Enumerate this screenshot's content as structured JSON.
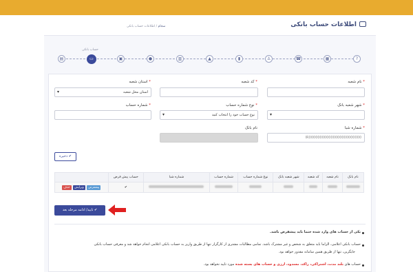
{
  "header": {
    "title": "اطلاعات حساب بانکی",
    "breadcrumb_home": "سجام",
    "breadcrumb_current": "اطلاعات حساب بانکی"
  },
  "steps": {
    "active_label": "حساب بانکی",
    "icons": [
      "document-icon",
      "bank-card-icon",
      "id-card-icon",
      "user-icon",
      "address-card-icon",
      "graduation-cap-icon",
      "bookmark-icon",
      "person-icon",
      "phone-icon",
      "certificate-icon",
      "question-icon",
      "home-icon"
    ]
  },
  "form": {
    "branch_name_label": "نام شعبه",
    "branch_code_label": "کد شعبه",
    "branch_province_label": "استان شعبه",
    "branch_province_value": "استان محل شعبه",
    "branch_city_label": "شهر شعبه بانک",
    "account_type_label": "نوع شماره حساب",
    "account_type_value": "نوع حساب خود را انتخاب کنید",
    "account_number_label": "شماره حساب",
    "sheba_label": "شماره شبا",
    "sheba_value": "IR000000000000000000000000",
    "bank_name_label": "نام بانک",
    "save_label": "ذخیره"
  },
  "table": {
    "headers": [
      "نام بانک",
      "نام شعبه",
      "کد شعبه",
      "شهر شعبه بانک",
      "نوع شماره حساب",
      "شماره حساب",
      "شماره شبا",
      "حساب پیش فرض",
      ""
    ],
    "row": {
      "bank": "بانک ملت",
      "branch": "شعبه",
      "code": "۱۲۳۴",
      "city": "تهران",
      "type": "کوتاه مدت",
      "default_mark": "✔",
      "delete": "حذف",
      "edit": "ویرایش",
      "set_default": "پیشفرض"
    }
  },
  "confirm_label": "تایید/ ادامه مرحله بعد",
  "notes": {
    "n1": "یکی از حساب های وارد شده حتما باید پیشفرض باشد.",
    "n2a": "حساب بانکی اعلامی، الزاما باید متعلق به شخص و غیر مشترک باشد. تمامی مطالبات مشتری از کارگزار تنها از طریق واریز به حساب بانکی اعلامی انجام خواهد شد و معرفی حساب بانکی",
    "n2b": "جایگزین، تنها از طریق همین سامانه مقدور خواهد بود.",
    "n3_pre": "حساب های",
    "n3_red": "بلند مدت، اشتراکی، راکد، مسدود، ارزی و حساب های بسته شده",
    "n3_post": "مورد تایید نخواهد بود."
  },
  "colors": {
    "topbar": "#e8ab2f",
    "primary": "#3b4a9b",
    "required": "#dd2222"
  }
}
